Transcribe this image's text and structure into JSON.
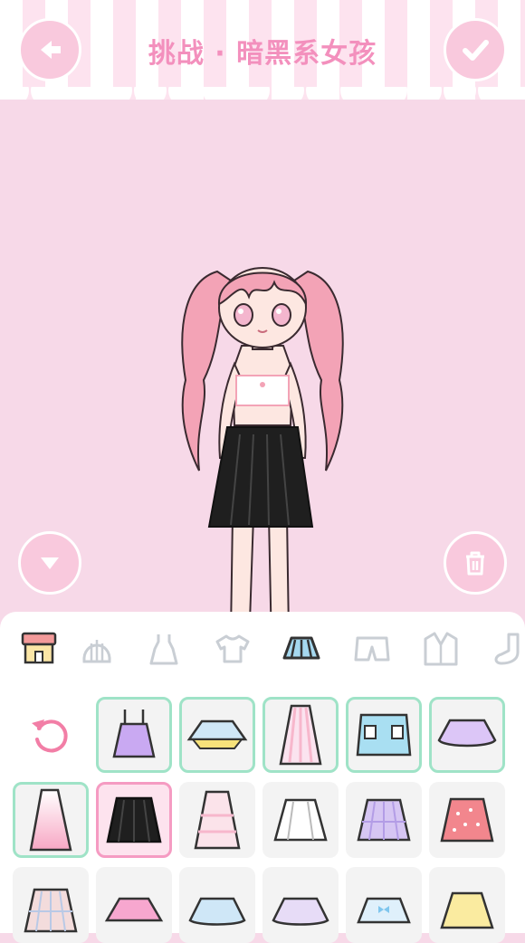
{
  "header": {
    "title": "挑战 · 暗黑系女孩",
    "back_icon": "arrow-left-icon",
    "confirm_icon": "check-icon"
  },
  "stage": {
    "collapse_icon": "triangle-down-icon",
    "trash_icon": "trash-icon"
  },
  "category_tabs": [
    {
      "name": "shop",
      "icon": "shop-icon",
      "active": false
    },
    {
      "name": "hair",
      "icon": "hair-icon",
      "active": false
    },
    {
      "name": "dress",
      "icon": "dress-icon",
      "active": false
    },
    {
      "name": "top",
      "icon": "tshirt-icon",
      "active": false
    },
    {
      "name": "skirt",
      "icon": "skirt-icon",
      "active": true
    },
    {
      "name": "shorts",
      "icon": "shorts-icon",
      "active": false
    },
    {
      "name": "jacket",
      "icon": "jacket-icon",
      "active": false
    },
    {
      "name": "socks",
      "icon": "sock-icon",
      "active": false
    }
  ],
  "items": [
    {
      "type": "reset",
      "icon": "reset-icon"
    },
    {
      "type": "suspender-skirt",
      "color": "#c9a9f2",
      "state": "owned"
    },
    {
      "type": "tutu",
      "color": "#cfe7f7",
      "accent": "#f7e27a",
      "state": "owned"
    },
    {
      "type": "striped-long-skirt",
      "color": "#f7b7cc",
      "state": "owned"
    },
    {
      "type": "mini-skirt",
      "color": "#a9dff2",
      "state": "owned"
    },
    {
      "type": "lace-skirt",
      "color": "#dcc6f7",
      "state": "owned"
    },
    {
      "type": "ombre-skirt",
      "color": "#f7b7cc",
      "state": "owned"
    },
    {
      "type": "pleated-skirt",
      "color": "#222222",
      "state": "selected"
    },
    {
      "type": "tiered-skirt",
      "color": "#fbe3ea",
      "state": "normal"
    },
    {
      "type": "white-skirt",
      "color": "#ffffff",
      "state": "normal"
    },
    {
      "type": "plaid-skirt",
      "color": "#d6c6f3",
      "state": "normal"
    },
    {
      "type": "dotted-skirt",
      "color": "#f2868d",
      "state": "normal"
    },
    {
      "type": "check-skirt",
      "color": "#f0c9c9",
      "state": "normal"
    },
    {
      "type": "pink-tutu",
      "color": "#f7a7cf",
      "state": "normal"
    },
    {
      "type": "blue-ruffle",
      "color": "#cfe7f7",
      "state": "normal"
    },
    {
      "type": "lavender-ruffle",
      "color": "#e7dcf7",
      "state": "normal"
    },
    {
      "type": "bow-skirt",
      "color": "#dff0fb",
      "state": "normal"
    },
    {
      "type": "yellow-skirt",
      "color": "#faeba0",
      "state": "normal"
    }
  ],
  "colors": {
    "background": "#f7d9e8",
    "accent_pink": "#f390bd",
    "owned_border": "#9fe3c7",
    "selected_border": "#f59bc2"
  }
}
